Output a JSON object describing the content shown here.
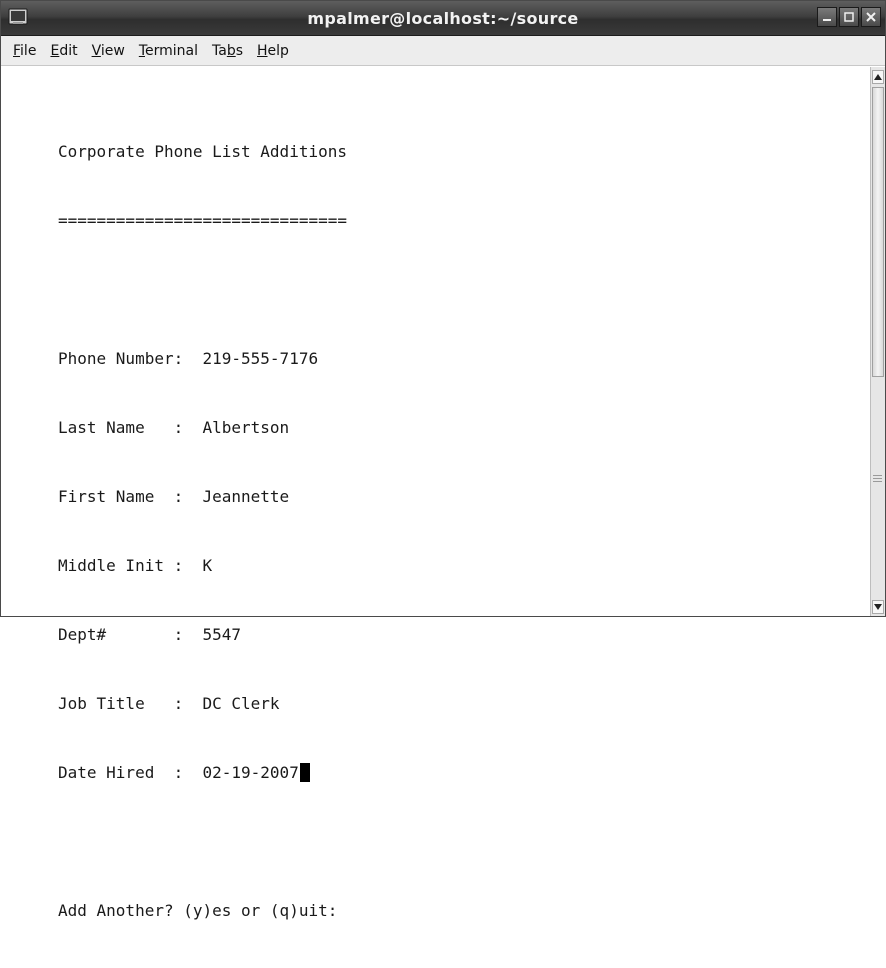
{
  "window": {
    "title": "mpalmer@localhost:~/source"
  },
  "menu": {
    "items": [
      {
        "id": "file",
        "mnemonic": "F",
        "rest": "ile"
      },
      {
        "id": "edit",
        "mnemonic": "E",
        "rest": "dit"
      },
      {
        "id": "view",
        "mnemonic": "V",
        "rest": "iew"
      },
      {
        "id": "terminal",
        "mnemonic": "T",
        "rest": "erminal"
      },
      {
        "id": "tabs",
        "pre": "Ta",
        "mnemonic": "b",
        "rest": "s"
      },
      {
        "id": "help",
        "mnemonic": "H",
        "rest": "elp"
      }
    ]
  },
  "terminal": {
    "lines": [
      "Corporate Phone List Additions",
      "==============================",
      "",
      "Phone Number:  219-555-7176",
      "Last Name   :  Albertson",
      "First Name  :  Jeannette",
      "Middle Init :  K",
      "Dept#       :  5547",
      "Job Title   :  DC Clerk",
      "Date Hired  :  02-19-2007",
      "",
      "Add Another? (y)es or (q)uit:"
    ]
  },
  "icons": {
    "app": "terminal-icon",
    "minimize": "minimize-icon",
    "maximize": "maximize-icon",
    "close": "close-icon",
    "scroll_up": "arrow-up-icon",
    "scroll_down": "arrow-down-icon"
  }
}
